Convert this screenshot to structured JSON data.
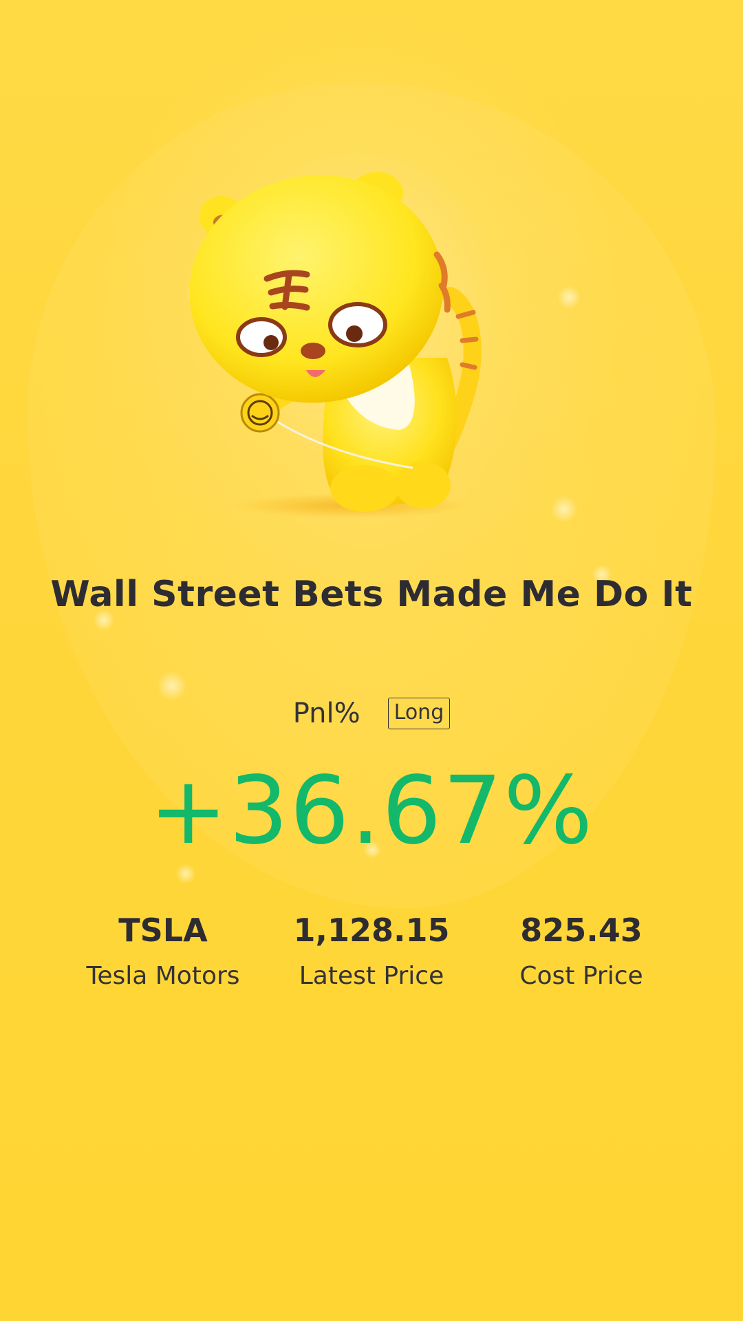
{
  "colors": {
    "background": "#ffd633",
    "text_dark": "#2e2c33",
    "positive": "#13b86a"
  },
  "header": {
    "mascot_icon": "tiger-mascot-with-yoyo"
  },
  "title": "Wall Street Bets Made Me Do It",
  "pnl": {
    "label": "Pnl%",
    "position_badge": "Long",
    "value": "+36.67%"
  },
  "stats": [
    {
      "value": "TSLA",
      "label": "Tesla Motors"
    },
    {
      "value": "1,128.15",
      "label": "Latest Price"
    },
    {
      "value": "825.43",
      "label": "Cost Price"
    }
  ]
}
